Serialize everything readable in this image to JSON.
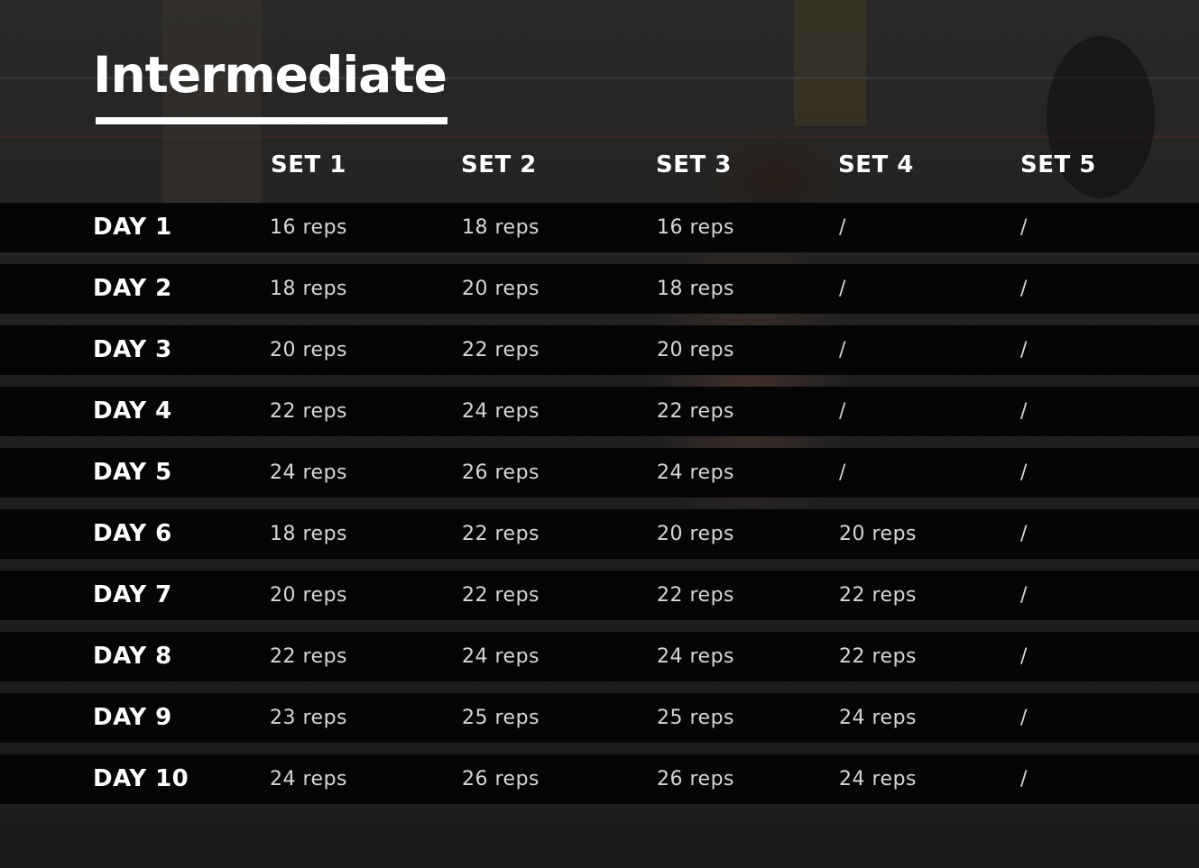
{
  "title": "Intermediate",
  "table": {
    "headers": [
      "SET 1",
      "SET 2",
      "SET 3",
      "SET 4",
      "SET 5"
    ],
    "rows": [
      {
        "day": "DAY 1",
        "sets": [
          "16 reps",
          "18 reps",
          "16 reps",
          "/",
          "/"
        ]
      },
      {
        "day": "DAY 2",
        "sets": [
          "18 reps",
          "20 reps",
          "18 reps",
          "/",
          "/"
        ]
      },
      {
        "day": "DAY 3",
        "sets": [
          "20 reps",
          "22 reps",
          "20 reps",
          "/",
          "/"
        ]
      },
      {
        "day": "DAY 4",
        "sets": [
          "22 reps",
          "24 reps",
          "22 reps",
          "/",
          "/"
        ]
      },
      {
        "day": "DAY 5",
        "sets": [
          "24 reps",
          "26 reps",
          "24 reps",
          "/",
          "/"
        ]
      },
      {
        "day": "DAY 6",
        "sets": [
          "18 reps",
          "22 reps",
          "20 reps",
          "20 reps",
          "/"
        ]
      },
      {
        "day": "DAY 7",
        "sets": [
          "20 reps",
          "22 reps",
          "22 reps",
          "22 reps",
          "/"
        ]
      },
      {
        "day": "DAY 8",
        "sets": [
          "22 reps",
          "24 reps",
          "24 reps",
          "22 reps",
          "/"
        ]
      },
      {
        "day": "DAY 9",
        "sets": [
          "23 reps",
          "25 reps",
          "25 reps",
          "24 reps",
          "/"
        ]
      },
      {
        "day": "DAY 10",
        "sets": [
          "24 reps",
          "26 reps",
          "26 reps",
          "24 reps",
          "/"
        ]
      }
    ]
  },
  "colors": {
    "row_background": "#050505",
    "title_text": "#ffffff",
    "reps_text": "#d6d6d6"
  }
}
